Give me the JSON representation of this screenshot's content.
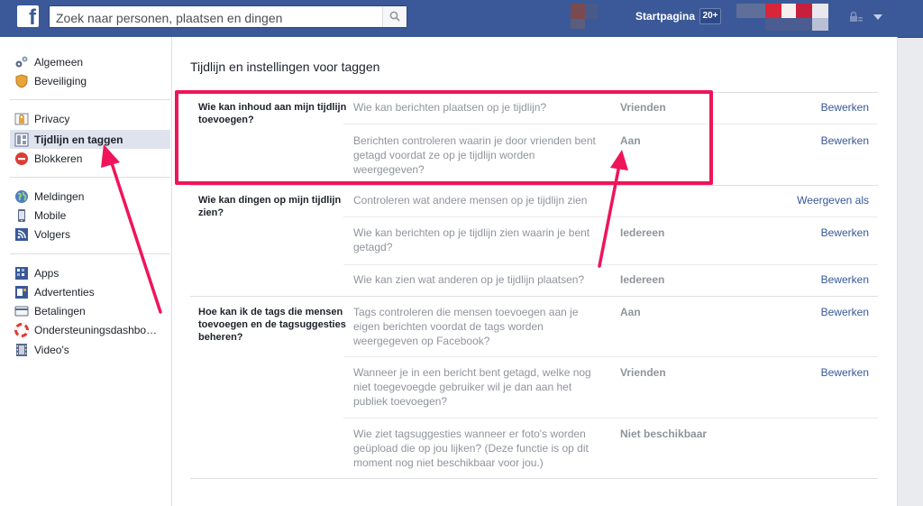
{
  "topbar": {
    "logo": "f",
    "search_placeholder": "Zoek naar personen, plaatsen en dingen",
    "home_label": "Startpagina",
    "notif_count": "20+",
    "icons": [
      "facebook-logo-icon",
      "search-icon",
      "lock-icon",
      "caret-down-icon"
    ]
  },
  "sidebar": {
    "groups": [
      [
        {
          "label": "Algemeen",
          "icon": "gears-icon"
        },
        {
          "label": "Beveiliging",
          "icon": "shield-icon"
        }
      ],
      [
        {
          "label": "Privacy",
          "icon": "padlock-icon"
        },
        {
          "label": "Tijdlijn en taggen",
          "icon": "timeline-icon",
          "active": true
        },
        {
          "label": "Blokkeren",
          "icon": "block-icon"
        }
      ],
      [
        {
          "label": "Meldingen",
          "icon": "globe-icon"
        },
        {
          "label": "Mobile",
          "icon": "phone-icon"
        },
        {
          "label": "Volgers",
          "icon": "rss-icon"
        }
      ],
      [
        {
          "label": "Apps",
          "icon": "apps-icon"
        },
        {
          "label": "Advertenties",
          "icon": "ads-icon"
        },
        {
          "label": "Betalingen",
          "icon": "card-icon"
        },
        {
          "label": "Ondersteuningsdashbo…",
          "icon": "lifebuoy-icon"
        },
        {
          "label": "Video's",
          "icon": "film-icon"
        }
      ]
    ]
  },
  "main": {
    "title": "Tijdlijn en instellingen voor taggen",
    "sections": [
      {
        "label": "Wie kan inhoud aan mijn tijdlijn toevoegen?",
        "rows": [
          {
            "question": "Wie kan berichten plaatsen op je tijdlijn?",
            "value": "Vrienden",
            "action": "Bewerken"
          },
          {
            "question": "Berichten controleren waarin je door vrienden bent getagd voordat ze op je tijdlijn worden weergegeven?",
            "value": "Aan",
            "action": "Bewerken"
          }
        ]
      },
      {
        "label": "Wie kan dingen op mijn tijdlijn zien?",
        "rows": [
          {
            "question": "Controleren wat andere mensen op je tijdlijn zien",
            "value": "",
            "action": "Weergeven als"
          },
          {
            "question": "Wie kan berichten op je tijdlijn zien waarin je bent getagd?",
            "value": "Iedereen",
            "action": "Bewerken"
          },
          {
            "question": "Wie kan zien wat anderen op je tijdlijn plaatsen?",
            "value": "Iedereen",
            "action": "Bewerken"
          }
        ]
      },
      {
        "label": "Hoe kan ik de tags die mensen toevoegen en de tagsuggesties beheren?",
        "rows": [
          {
            "question": "Tags controleren die mensen toevoegen aan je eigen berichten voordat de tags worden weergegeven op Facebook?",
            "value": "Aan",
            "action": "Bewerken"
          },
          {
            "question": "Wanneer je in een bericht bent getagd, welke nog niet toegevoegde gebruiker wil je dan aan het publiek toevoegen?",
            "value": "Vrienden",
            "action": "Bewerken"
          },
          {
            "question": "Wie ziet tagsuggesties wanneer er foto's worden geüpload die op jou lijken? (Deze functie is op dit moment nog niet beschikbaar voor jou.)",
            "value": "Niet beschikbaar",
            "action": ""
          }
        ]
      }
    ]
  },
  "colors": {
    "topbar": "#3b5998",
    "link": "#365899",
    "highlight": "#f0145a",
    "active_item": "#dfe3ee"
  }
}
